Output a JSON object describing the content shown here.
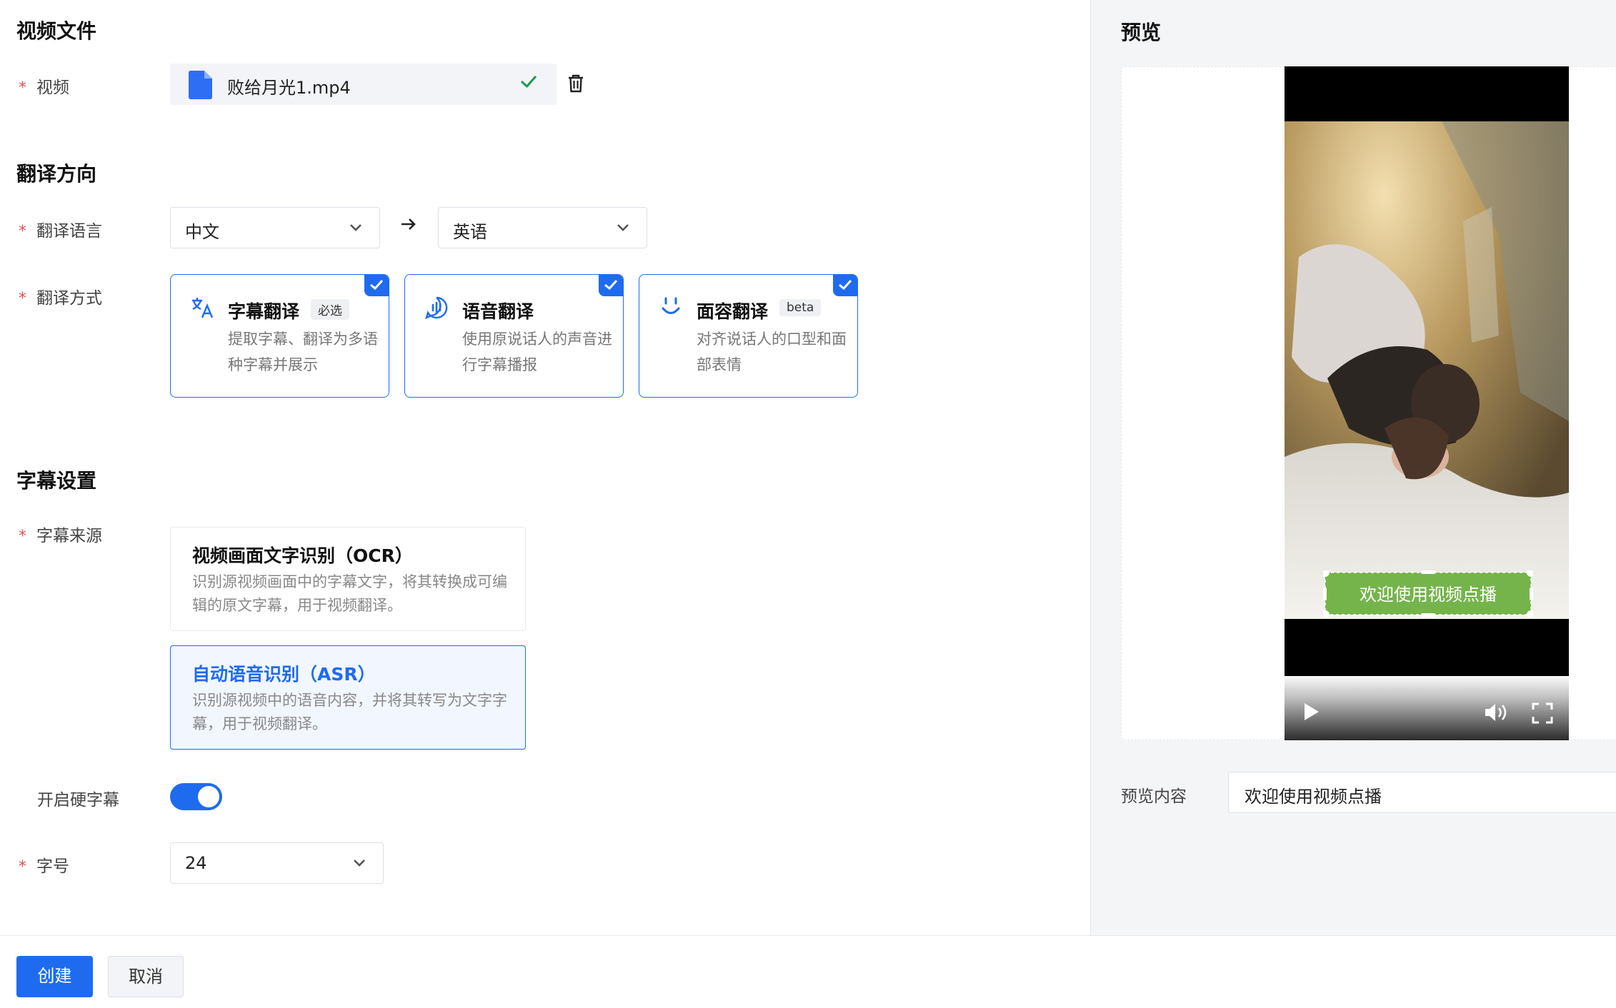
{
  "video_section": {
    "title": "视频文件",
    "label": "视频",
    "file_name": "败给月光1.mp4"
  },
  "direction_section": {
    "title": "翻译方向",
    "language_label": "翻译语言",
    "source_language": "中文",
    "target_language": "英语",
    "method_label": "翻译方式",
    "methods": [
      {
        "title": "字幕翻译",
        "tag": "必选",
        "desc": "提取字幕、翻译为多语种字幕并展示",
        "checked": true,
        "icon": "translate-icon"
      },
      {
        "title": "语音翻译",
        "tag": "",
        "desc": "使用原说话人的声音进行字幕播报",
        "checked": true,
        "icon": "voice-icon"
      },
      {
        "title": "面容翻译",
        "tag": "beta",
        "desc": "对齐说话人的口型和面部表情",
        "checked": true,
        "icon": "face-icon"
      }
    ]
  },
  "subtitle_section": {
    "title": "字幕设置",
    "source_label": "字幕来源",
    "sources": [
      {
        "title": "视频画面文字识别（OCR）",
        "desc": "识别源视频画面中的字幕文字，将其转换成可编辑的原文字幕，用于视频翻译。",
        "selected": false
      },
      {
        "title": "自动语音识别（ASR）",
        "desc": "识别源视频中的语音内容，并将其转写为文字字幕，用于视频翻译。",
        "selected": true
      }
    ],
    "hard_subtitle_label": "开启硬字幕",
    "hard_subtitle_on": true,
    "font_size_label": "字号",
    "font_size": "24"
  },
  "preview": {
    "title": "预览",
    "subtitle_overlay": "欢迎使用视频点播",
    "content_label": "预览内容",
    "content_value": "欢迎使用视频点播"
  },
  "footer": {
    "create_label": "创建",
    "cancel_label": "取消"
  },
  "colors": {
    "primary": "#1e6bf0",
    "required": "#e34d59",
    "success": "#1f9d55",
    "subtitle_bg": "#6aaf3d"
  }
}
